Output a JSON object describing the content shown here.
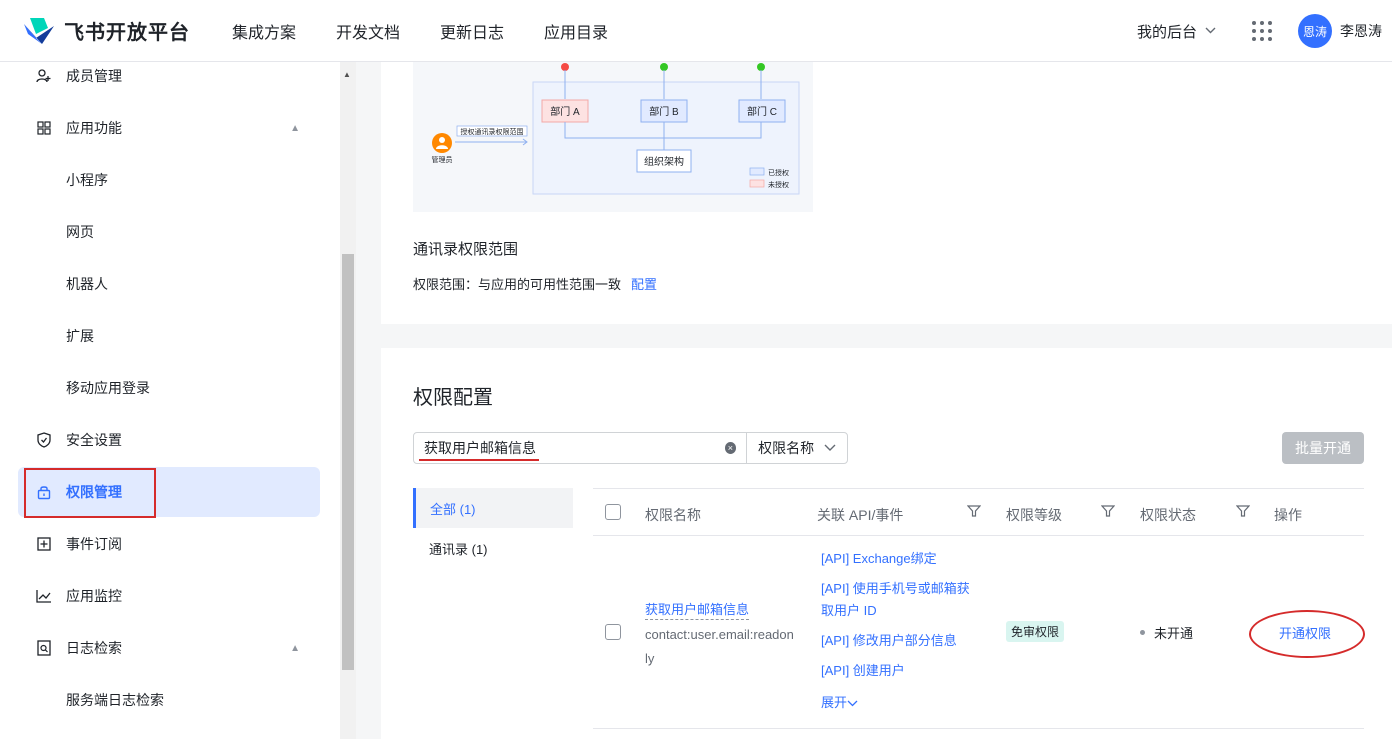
{
  "brand": {
    "name": "飞书开放平台"
  },
  "nav": {
    "items": [
      "集成方案",
      "开发文档",
      "更新日志",
      "应用目录"
    ],
    "backend": "我的后台",
    "avatar_text": "恩涛",
    "username": "李恩涛"
  },
  "sidebar": {
    "members": "成员管理",
    "app_features": "应用功能",
    "mini_program": "小程序",
    "web_page": "网页",
    "bot": "机器人",
    "extension": "扩展",
    "mobile_login": "移动应用登录",
    "security": "安全设置",
    "permissions": "权限管理",
    "events": "事件订阅",
    "monitoring": "应用监控",
    "log_search": "日志检索",
    "server_log": "服务端日志检索"
  },
  "diagram": {
    "dept_a": "部门 A",
    "dept_b": "部门 B",
    "dept_c": "部门 C",
    "org": "组织架构",
    "admin": "管理员",
    "grant_label": "授权通讯录权限范围",
    "legend_authorized": "已授权",
    "legend_unauthorized": "未授权"
  },
  "scope": {
    "title": "通讯录权限范围",
    "label": "权限范围：",
    "value": "与应用的可用性范围一致",
    "configure": "配置"
  },
  "permissions": {
    "title": "权限配置",
    "search_value": "获取用户邮箱信息",
    "search_type": "权限名称",
    "batch_open": "批量开通",
    "categories": {
      "all": "全部 (1)",
      "contact": "通讯录 (1)"
    },
    "headers": {
      "name": "权限名称",
      "api": "关联 API/事件",
      "level": "权限等级",
      "status": "权限状态",
      "action": "操作"
    },
    "row": {
      "name": "获取用户邮箱信息",
      "code": "contact:user.email:readonly",
      "apis": [
        "[API] Exchange绑定",
        "[API] 使用手机号或邮箱获",
        "取用户 ID",
        "[API] 修改用户部分信息",
        "[API] 创建用户"
      ],
      "expand": "展开",
      "level": "免审权限",
      "status": "未开通",
      "action": "开通权限"
    }
  },
  "colors": {
    "accent": "#3370ff",
    "annotation": "#d52b2b",
    "tag_bg": "#d9f5f0"
  }
}
